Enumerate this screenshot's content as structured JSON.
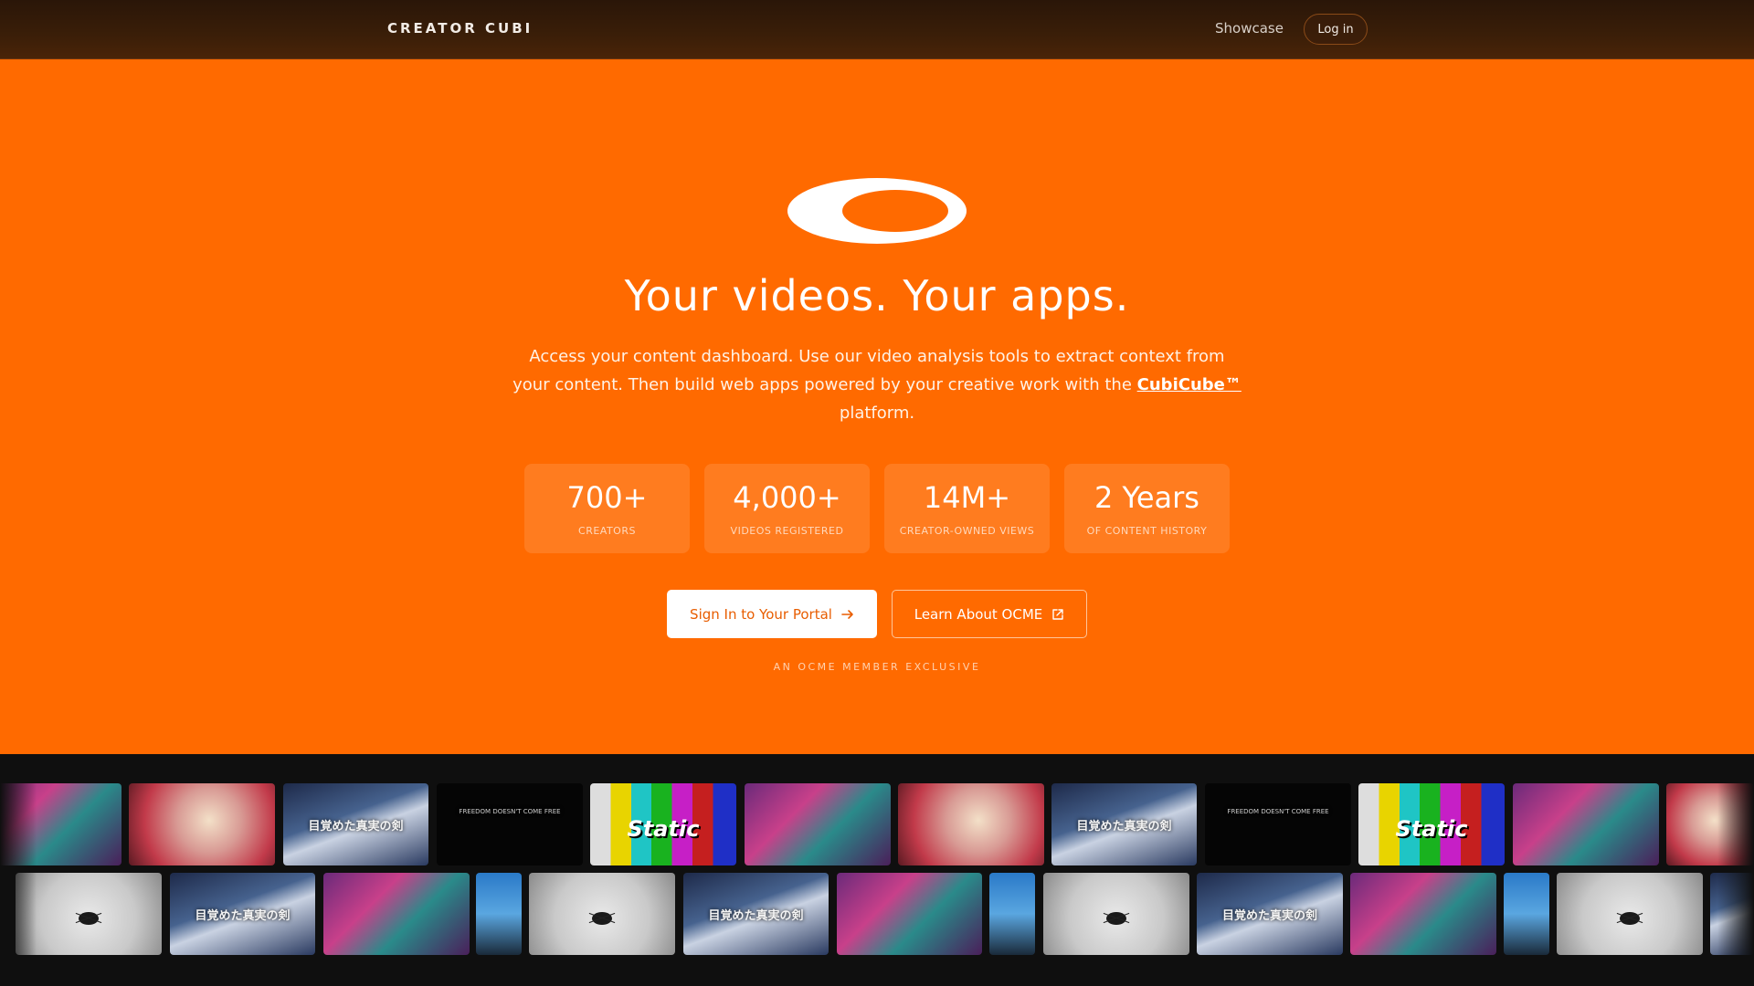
{
  "header": {
    "brand": "CREATOR CUBI",
    "nav_showcase": "Showcase",
    "login_label": "Log in"
  },
  "hero": {
    "logo_icon": "ring-logo-icon",
    "title": "Your videos. Your apps.",
    "description_before": "Access your content dashboard. Use our video analysis tools to extract context from your content. Then build web apps powered by your creative work with the",
    "description_link": "CubiCube™",
    "description_after": "platform.",
    "stats": [
      {
        "value": "700+",
        "label": "CREATORS"
      },
      {
        "value": "4,000+",
        "label": "VIDEOS REGISTERED"
      },
      {
        "value": "14M+",
        "label": "CREATOR-OWNED VIEWS"
      },
      {
        "value": "2 Years",
        "label": "OF CONTENT HISTORY"
      }
    ],
    "primary_button": "Sign In to Your Portal",
    "secondary_button": "Learn About OCME",
    "exclusive_note": "AN OCME MEMBER EXCLUSIVE"
  },
  "thumbnails": {
    "sword_caption": "目覚めた真実の剣",
    "static_caption": "Static",
    "black_caption": "FREEDOM DOESN'T COME FREE"
  },
  "colors": {
    "hero_bg": "#ff6a00",
    "header_bg": "#2a1608",
    "primary_text": "#e85d00"
  }
}
